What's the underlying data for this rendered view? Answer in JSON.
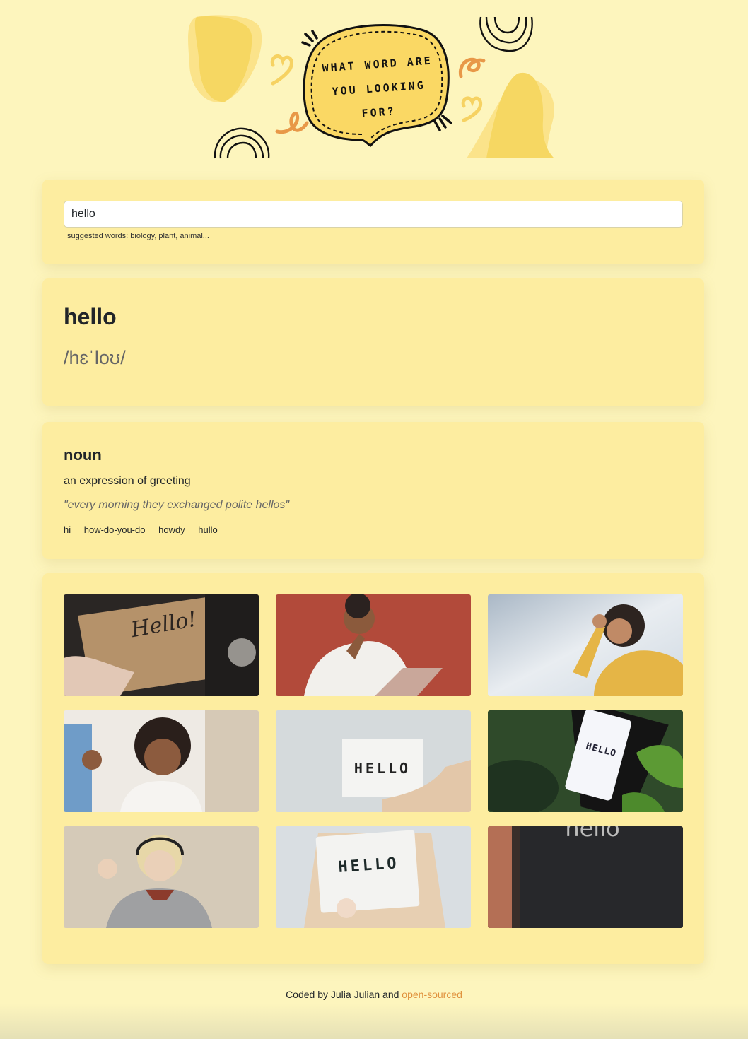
{
  "header": {
    "bubble_lines": [
      "WHAT WORD ARE",
      "YOU LOOKING",
      "FOR?"
    ],
    "colors": {
      "blob": "#f7da6a",
      "bubble": "#fad864",
      "accent": "#e89848"
    }
  },
  "search": {
    "value": "hello",
    "hint": "suggested words: biology, plant, animal..."
  },
  "word": {
    "title": "hello",
    "phonetic": "/hɛˈloʊ/"
  },
  "meaning": {
    "part_of_speech": "noun",
    "definition": "an expression of greeting",
    "example": "\"every morning they exchanged polite hellos\"",
    "synonyms": [
      "hi",
      "how-do-you-do",
      "howdy",
      "hullo"
    ]
  },
  "photos": {
    "captions": [
      "HELLO",
      "HELLO",
      "HELLO",
      "hello"
    ]
  },
  "footer": {
    "text": "Coded by Julia Julian and ",
    "link": "open-sourced"
  }
}
